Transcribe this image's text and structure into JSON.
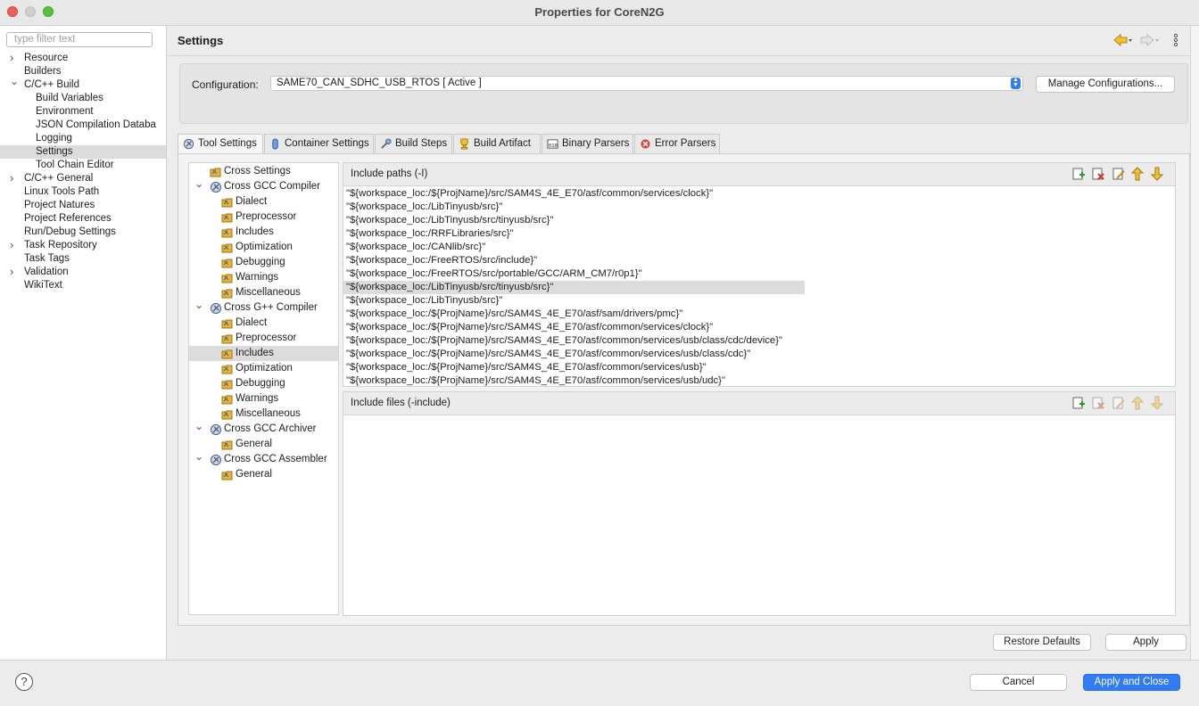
{
  "window": {
    "title": "Properties for CoreN2G"
  },
  "filter": {
    "placeholder": "type filter text"
  },
  "nav": [
    {
      "label": "Resource",
      "chevron": "right",
      "depth": 0
    },
    {
      "label": "Builders",
      "chevron": "",
      "depth": 0
    },
    {
      "label": "C/C++ Build",
      "chevron": "down",
      "depth": 0
    },
    {
      "label": "Build Variables",
      "chevron": "",
      "depth": 1
    },
    {
      "label": "Environment",
      "chevron": "",
      "depth": 1
    },
    {
      "label": "JSON Compilation Databa",
      "chevron": "",
      "depth": 1
    },
    {
      "label": "Logging",
      "chevron": "",
      "depth": 1
    },
    {
      "label": "Settings",
      "chevron": "",
      "depth": 1,
      "selected": true
    },
    {
      "label": "Tool Chain Editor",
      "chevron": "",
      "depth": 1
    },
    {
      "label": "C/C++ General",
      "chevron": "right",
      "depth": 0
    },
    {
      "label": "Linux Tools Path",
      "chevron": "",
      "depth": 0
    },
    {
      "label": "Project Natures",
      "chevron": "",
      "depth": 0
    },
    {
      "label": "Project References",
      "chevron": "",
      "depth": 0
    },
    {
      "label": "Run/Debug Settings",
      "chevron": "",
      "depth": 0
    },
    {
      "label": "Task Repository",
      "chevron": "right",
      "depth": 0
    },
    {
      "label": "Task Tags",
      "chevron": "",
      "depth": 0
    },
    {
      "label": "Validation",
      "chevron": "right",
      "depth": 0
    },
    {
      "label": "WikiText",
      "chevron": "",
      "depth": 0
    }
  ],
  "header": {
    "title": "Settings",
    "back_icon": "back-arrow-icon",
    "forward_icon": "forward-arrow-icon",
    "menu_icon": "kebab-menu-icon"
  },
  "configuration": {
    "label": "Configuration:",
    "value": "SAME70_CAN_SDHC_USB_RTOS  [ Active ]",
    "manage_label": "Manage Configurations..."
  },
  "tabs": [
    {
      "label": "Tool Settings",
      "icon": "tool-settings-icon",
      "active": true
    },
    {
      "label": "Container Settings",
      "icon": "container-icon"
    },
    {
      "label": "Build Steps",
      "icon": "build-steps-icon"
    },
    {
      "label": "Build Artifact",
      "icon": "build-artifact-icon"
    },
    {
      "label": "Binary Parsers",
      "icon": "binary-parsers-icon"
    },
    {
      "label": "Error Parsers",
      "icon": "error-parsers-icon"
    }
  ],
  "tool_tree": [
    {
      "label": "Cross Settings",
      "type": "leaf-top",
      "chevron": ""
    },
    {
      "label": "Cross GCC Compiler",
      "type": "tool",
      "chevron": "down"
    },
    {
      "label": "Dialect",
      "type": "option"
    },
    {
      "label": "Preprocessor",
      "type": "option"
    },
    {
      "label": "Includes",
      "type": "option"
    },
    {
      "label": "Optimization",
      "type": "option"
    },
    {
      "label": "Debugging",
      "type": "option"
    },
    {
      "label": "Warnings",
      "type": "option"
    },
    {
      "label": "Miscellaneous",
      "type": "option"
    },
    {
      "label": "Cross G++ Compiler",
      "type": "tool",
      "chevron": "down"
    },
    {
      "label": "Dialect",
      "type": "option"
    },
    {
      "label": "Preprocessor",
      "type": "option"
    },
    {
      "label": "Includes",
      "type": "option",
      "selected": true
    },
    {
      "label": "Optimization",
      "type": "option"
    },
    {
      "label": "Debugging",
      "type": "option"
    },
    {
      "label": "Warnings",
      "type": "option"
    },
    {
      "label": "Miscellaneous",
      "type": "option"
    },
    {
      "label": "Cross GCC Archiver",
      "type": "tool",
      "chevron": "down"
    },
    {
      "label": "General",
      "type": "option"
    },
    {
      "label": "Cross GCC Assembler",
      "type": "tool",
      "chevron": "down"
    },
    {
      "label": "General",
      "type": "option"
    }
  ],
  "include_paths": {
    "title": "Include paths (-I)",
    "tools": [
      "add-icon",
      "delete-icon",
      "edit-icon",
      "move-up-icon",
      "move-down-icon"
    ],
    "items": [
      "\"${workspace_loc:/${ProjName}/src/SAM4S_4E_E70/asf/common/services/clock}\"",
      "\"${workspace_loc:/LibTinyusb/src}\"",
      "\"${workspace_loc:/LibTinyusb/src/tinyusb/src}\"",
      "\"${workspace_loc:/RRFLibraries/src}\"",
      "\"${workspace_loc:/CANlib/src}\"",
      "\"${workspace_loc:/FreeRTOS/src/include}\"",
      "\"${workspace_loc:/FreeRTOS/src/portable/GCC/ARM_CM7/r0p1}\"",
      "\"${workspace_loc:/LibTinyusb/src/tinyusb/src}\"",
      "\"${workspace_loc:/LibTinyusb/src}\"",
      "\"${workspace_loc:/${ProjName}/src/SAM4S_4E_E70/asf/sam/drivers/pmc}\"",
      "\"${workspace_loc:/${ProjName}/src/SAM4S_4E_E70/asf/common/services/clock}\"",
      "\"${workspace_loc:/${ProjName}/src/SAM4S_4E_E70/asf/common/services/usb/class/cdc/device}\"",
      "\"${workspace_loc:/${ProjName}/src/SAM4S_4E_E70/asf/common/services/usb/class/cdc}\"",
      "\"${workspace_loc:/${ProjName}/src/SAM4S_4E_E70/asf/common/services/usb}\"",
      "\"${workspace_loc:/${ProjName}/src/SAM4S_4E_E70/asf/common/services/usb/udc}\""
    ],
    "selected_index": 7
  },
  "include_files": {
    "title": "Include files (-include)",
    "tools": [
      "add-icon",
      "delete-icon",
      "edit-icon",
      "move-up-icon",
      "move-down-icon"
    ],
    "items": []
  },
  "buttons": {
    "restore_defaults": "Restore Defaults",
    "apply": "Apply",
    "cancel": "Cancel",
    "apply_and_close": "Apply and Close",
    "help": "?"
  },
  "colors": {
    "accent": "#2f7cf6",
    "selection": "#dcdcdc",
    "folder": "#e8b53a"
  }
}
